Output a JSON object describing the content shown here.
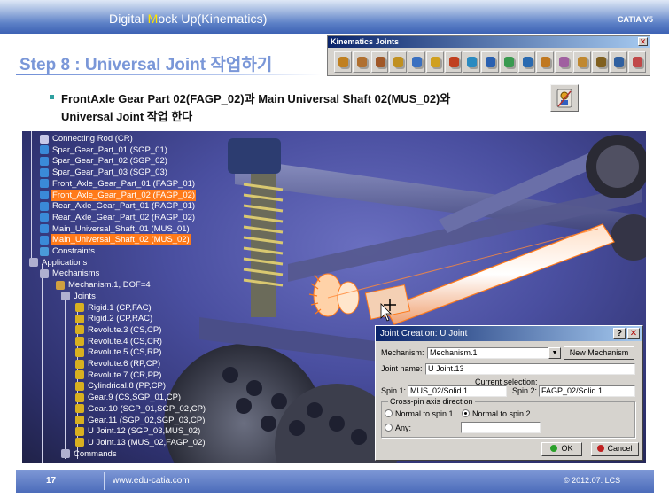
{
  "header": {
    "title_pre": "Digital ",
    "title_m": "M",
    "title_post": "ock Up(Kinematics)",
    "brand": "CATIA V5"
  },
  "step_title": "Step 8 : Universal Joint 작업하기",
  "toolbar": {
    "title": "Kinematics Joints",
    "close": "✕",
    "icons": [
      "revolute-joint",
      "prismatic-joint",
      "cylindrical-joint",
      "screw-joint",
      "spherical-joint",
      "planar-joint",
      "rigid-joint",
      "point-curve-joint",
      "slide-curve-joint",
      "roll-curve-joint",
      "point-surface-joint",
      "universal-joint",
      "cv-joint",
      "gear-joint",
      "rack-joint",
      "cable-joint",
      "axis-system-joint"
    ]
  },
  "instruction": {
    "line1": "FrontAxle Gear Part 02(FAGP_02)과 Main Universal Shaft 02(MUS_02)와",
    "line2": "Universal Joint 작업 한다"
  },
  "tree": [
    {
      "label": "Connecting Rod (CR)",
      "sel": false
    },
    {
      "label": "Spar_Gear_Part_01 (SGP_01)",
      "sel": false
    },
    {
      "label": "Spar_Gear_Part_02 (SGP_02)",
      "sel": false
    },
    {
      "label": "Spar_Gear_Part_03 (SGP_03)",
      "sel": false
    },
    {
      "label": "Front_Axle_Gear_Part_01 (FAGP_01)",
      "sel": false
    },
    {
      "label": "Front_Axle_Gear_Part_02 (FAGP_02)",
      "sel": true
    },
    {
      "label": "Rear_Axle_Gear_Part_01 (RAGP_01)",
      "sel": false
    },
    {
      "label": "Rear_Axle_Gear_Part_02 (RAGP_02)",
      "sel": false
    },
    {
      "label": "Main_Universal_Shaft_01 (MUS_01)",
      "sel": false
    },
    {
      "label": "Main_Universal_Shaft_02 (MUS_02)",
      "sel": true
    },
    {
      "label": "Constraints",
      "sel": false
    },
    {
      "label": "Applications",
      "sel": false
    },
    {
      "label": "Mechanisms",
      "sel": false
    },
    {
      "label": "Mechanism.1, DOF=4",
      "sel": false
    },
    {
      "label": "Joints",
      "sel": false
    },
    {
      "label": "Rigid.1 (CP,FAC)",
      "sel": false
    },
    {
      "label": "Rigid.2 (CP,RAC)",
      "sel": false
    },
    {
      "label": "Revolute.3 (CS,CP)",
      "sel": false
    },
    {
      "label": "Revolute.4 (CS,CR)",
      "sel": false
    },
    {
      "label": "Revolute.5 (CS,RP)",
      "sel": false
    },
    {
      "label": "Revolute.6 (RP,CP)",
      "sel": false
    },
    {
      "label": "Revolute.7 (CR,PP)",
      "sel": false
    },
    {
      "label": "Cylindrical.8 (PP,CP)",
      "sel": false
    },
    {
      "label": "Gear.9 (CS,SGP_01,CP)",
      "sel": false
    },
    {
      "label": "Gear.10 (SGP_01,SGP_02,CP)",
      "sel": false
    },
    {
      "label": "Gear.11 (SGP_02,SGP_03,CP)",
      "sel": false
    },
    {
      "label": "U Joint.12 (SGP_03,MUS_02)",
      "sel": false
    },
    {
      "label": "U Joint.13 (MUS_02,FAGP_02)",
      "sel": false
    },
    {
      "label": "Commands",
      "sel": false
    }
  ],
  "dialog": {
    "title": "Joint Creation: U Joint",
    "help": "?",
    "close": "✕",
    "mechanism_label": "Mechanism:",
    "mechanism_value": "Mechanism.1",
    "new_mechanism": "New Mechanism",
    "joint_name_label": "Joint name:",
    "joint_name_value": "U Joint.13",
    "current_selection": "Current selection:",
    "spin1_label": "Spin 1:",
    "spin1_value": "MUS_02/Solid.1",
    "spin2_label": "Spin 2:",
    "spin2_value": "FAGP_02/Solid.1",
    "cross_pin_title": "Cross-pin axis direction",
    "normal1": "Normal to spin 1",
    "normal2": "Normal to spin 2",
    "any": "Any:",
    "any_value": "",
    "selected_option": "normal2",
    "ok": "OK",
    "cancel": "Cancel"
  },
  "footer": {
    "page": "17",
    "url": "www.edu-catia.com",
    "copyright": "© 2012.07. LCS"
  },
  "colors": {
    "accent": "#7a97d8",
    "selection": "#ff7a1a",
    "title_bar": "#0a246a"
  }
}
